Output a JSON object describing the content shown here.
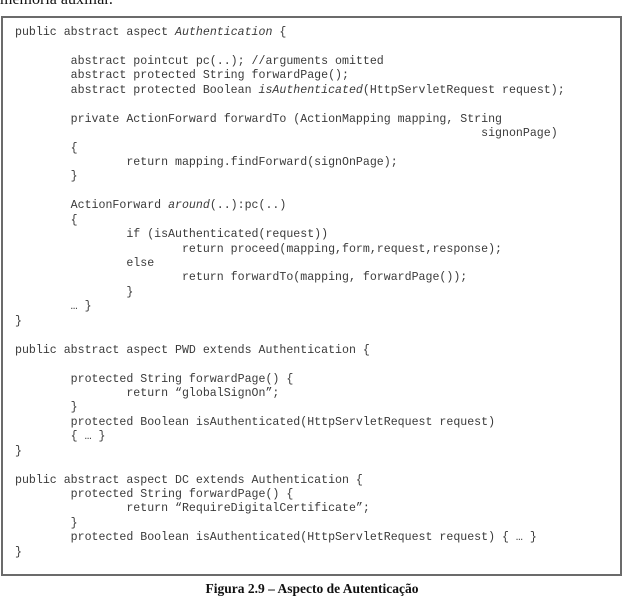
{
  "top_text": "memória auxiliar.",
  "code_lines": [
    {
      "segments": [
        {
          "t": "public abstract aspect "
        },
        {
          "t": "Authentication",
          "i": true
        },
        {
          "t": " {"
        }
      ]
    },
    {
      "segments": [
        {
          "t": ""
        }
      ]
    },
    {
      "segments": [
        {
          "t": "        abstract pointcut pc(..); //arguments omitted"
        }
      ]
    },
    {
      "segments": [
        {
          "t": "        abstract protected String forwardPage();"
        }
      ]
    },
    {
      "segments": [
        {
          "t": "        abstract protected Boolean "
        },
        {
          "t": "isAuthenticated",
          "i": true
        },
        {
          "t": "(HttpServletRequest request);"
        }
      ]
    },
    {
      "segments": [
        {
          "t": ""
        }
      ]
    },
    {
      "segments": [
        {
          "t": "        private ActionForward forwardTo (ActionMapping mapping, String"
        }
      ]
    },
    {
      "segments": [
        {
          "t": "                                                                   signonPage)"
        }
      ]
    },
    {
      "segments": [
        {
          "t": "        {"
        }
      ]
    },
    {
      "segments": [
        {
          "t": "                return mapping.findForward(signOnPage);"
        }
      ]
    },
    {
      "segments": [
        {
          "t": "        }"
        }
      ]
    },
    {
      "segments": [
        {
          "t": ""
        }
      ]
    },
    {
      "segments": [
        {
          "t": "        ActionForward "
        },
        {
          "t": "around",
          "i": true
        },
        {
          "t": "(..):pc(..)"
        }
      ]
    },
    {
      "segments": [
        {
          "t": "        {"
        }
      ]
    },
    {
      "segments": [
        {
          "t": "                if (isAuthenticated(request))"
        }
      ]
    },
    {
      "segments": [
        {
          "t": "                        return proceed(mapping,form,request,response);"
        }
      ]
    },
    {
      "segments": [
        {
          "t": "                else"
        }
      ]
    },
    {
      "segments": [
        {
          "t": "                        return forwardTo(mapping, forwardPage());"
        }
      ]
    },
    {
      "segments": [
        {
          "t": "                }"
        }
      ]
    },
    {
      "segments": [
        {
          "t": "        … }"
        }
      ]
    },
    {
      "segments": [
        {
          "t": "}"
        }
      ]
    },
    {
      "segments": [
        {
          "t": ""
        }
      ]
    },
    {
      "segments": [
        {
          "t": "public abstract aspect PWD extends Authentication {"
        }
      ]
    },
    {
      "segments": [
        {
          "t": ""
        }
      ]
    },
    {
      "segments": [
        {
          "t": "        protected String forwardPage() {"
        }
      ]
    },
    {
      "segments": [
        {
          "t": "                return “globalSignOn”;"
        }
      ]
    },
    {
      "segments": [
        {
          "t": "        }"
        }
      ]
    },
    {
      "segments": [
        {
          "t": "        protected Boolean isAuthenticated(HttpServletRequest request)"
        }
      ]
    },
    {
      "segments": [
        {
          "t": "        { … }"
        }
      ]
    },
    {
      "segments": [
        {
          "t": "}"
        }
      ]
    },
    {
      "segments": [
        {
          "t": ""
        }
      ]
    },
    {
      "segments": [
        {
          "t": "public abstract aspect DC extends Authentication {"
        }
      ]
    },
    {
      "segments": [
        {
          "t": "        protected String forwardPage() {"
        }
      ]
    },
    {
      "segments": [
        {
          "t": "                return “RequireDigitalCertificate”;"
        }
      ]
    },
    {
      "segments": [
        {
          "t": "        }"
        }
      ]
    },
    {
      "segments": [
        {
          "t": "        protected Boolean isAuthenticated(HttpServletRequest request) { … }"
        }
      ]
    },
    {
      "segments": [
        {
          "t": "}"
        }
      ]
    }
  ],
  "caption": "Figura 2.9 – Aspecto de Autenticação"
}
